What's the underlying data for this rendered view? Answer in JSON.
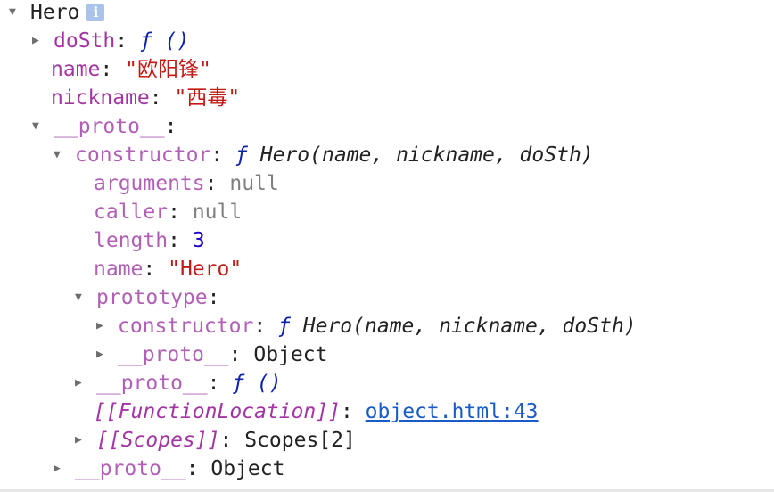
{
  "tree": {
    "root_name": "Hero",
    "info_icon": "info-icon",
    "rows": {
      "doSth_key": "doSth",
      "doSth_value": "ƒ ()",
      "name_key": "name",
      "name_value": "\"欧阳锋\"",
      "nickname_key": "nickname",
      "nickname_value": "\"西毒\"",
      "proto_key": "__proto__",
      "constructor_key": "constructor",
      "constructor_f": "ƒ",
      "constructor_sig": "Hero(name, nickname, doSth)",
      "arguments_key": "arguments",
      "arguments_value": "null",
      "caller_key": "caller",
      "caller_value": "null",
      "length_key": "length",
      "length_value": "3",
      "fname_key": "name",
      "fname_value": "\"Hero\"",
      "prototype_key": "prototype",
      "proto_constructor_key": "constructor",
      "proto_constructor_f": "ƒ",
      "proto_constructor_sig": "Hero(name, nickname, doSth)",
      "proto_proto_key": "__proto__",
      "proto_proto_value": "Object",
      "fn_proto_key": "__proto__",
      "fn_proto_value": "ƒ ()",
      "function_location_key": "[[FunctionLocation]]",
      "function_location_value": "object.html:43",
      "scopes_key": "[[Scopes]]",
      "scopes_value": "Scopes[2]",
      "outer_proto_key": "__proto__",
      "outer_proto_value": "Object"
    },
    "colon": ":"
  }
}
